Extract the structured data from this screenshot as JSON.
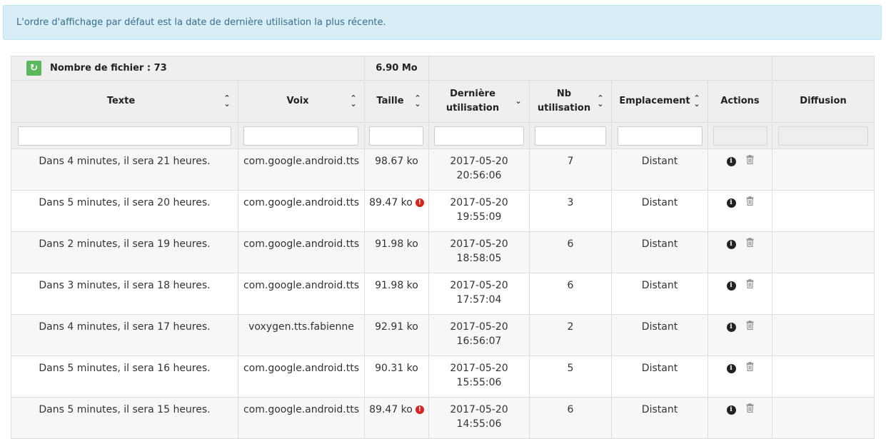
{
  "alert": {
    "text": "L'ordre d'affichage par défaut est la date de dernière utilisation la plus récente."
  },
  "summary": {
    "refresh_icon": "refresh-icon",
    "file_count_label": "Nombre de fichier : 73",
    "total_size": "6.90 Mo"
  },
  "columns": {
    "texte": "Texte",
    "voix": "Voix",
    "taille": "Taille",
    "derniere_line1": "Dernière",
    "derniere_line2": "utilisation",
    "nb_line1": "Nb",
    "nb_line2": "utilisation",
    "emplacement": "Emplacement",
    "actions": "Actions",
    "diffusion": "Diffusion"
  },
  "colors": {
    "alert_bg": "#d9edf7",
    "alert_text": "#31708f",
    "refresh": "#5cb85c",
    "warning": "#d9231d"
  },
  "rows": [
    {
      "texte": "Dans 4 minutes, il sera 21 heures.",
      "voix": "com.google.android.tts",
      "taille": "98.67 ko",
      "warning": false,
      "date": "2017-05-20",
      "time": "20:56:06",
      "nb": "7",
      "emplacement": "Distant"
    },
    {
      "texte": "Dans 5 minutes, il sera 20 heures.",
      "voix": "com.google.android.tts",
      "taille": "89.47 ko",
      "warning": true,
      "date": "2017-05-20",
      "time": "19:55:09",
      "nb": "3",
      "emplacement": "Distant"
    },
    {
      "texte": "Dans 2 minutes, il sera 19 heures.",
      "voix": "com.google.android.tts",
      "taille": "91.98 ko",
      "warning": false,
      "date": "2017-05-20",
      "time": "18:58:05",
      "nb": "6",
      "emplacement": "Distant"
    },
    {
      "texte": "Dans 3 minutes, il sera 18 heures.",
      "voix": "com.google.android.tts",
      "taille": "91.98 ko",
      "warning": false,
      "date": "2017-05-20",
      "time": "17:57:04",
      "nb": "6",
      "emplacement": "Distant"
    },
    {
      "texte": "Dans 4 minutes, il sera 17 heures.",
      "voix": "voxygen.tts.fabienne",
      "taille": "92.91 ko",
      "warning": false,
      "date": "2017-05-20",
      "time": "16:56:07",
      "nb": "2",
      "emplacement": "Distant"
    },
    {
      "texte": "Dans 5 minutes, il sera 16 heures.",
      "voix": "com.google.android.tts",
      "taille": "90.31 ko",
      "warning": false,
      "date": "2017-05-20",
      "time": "15:55:06",
      "nb": "5",
      "emplacement": "Distant"
    },
    {
      "texte": "Dans 5 minutes, il sera 15 heures.",
      "voix": "com.google.android.tts",
      "taille": "89.47 ko",
      "warning": true,
      "date": "2017-05-20",
      "time": "14:55:06",
      "nb": "6",
      "emplacement": "Distant"
    }
  ]
}
